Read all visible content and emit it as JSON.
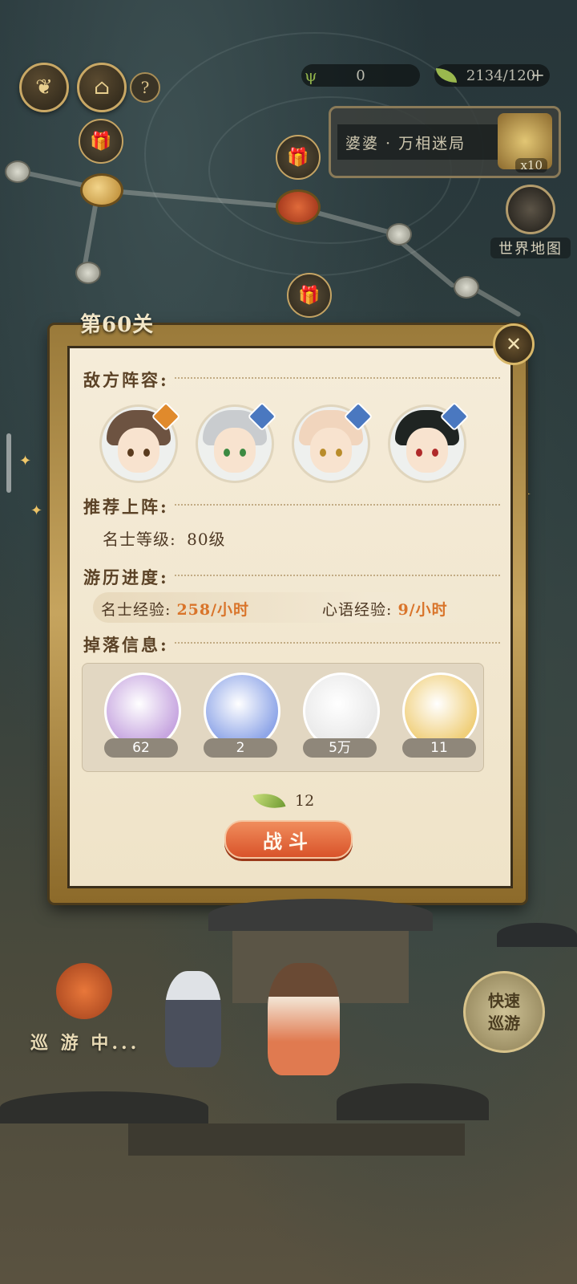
{
  "hud": {
    "resource1_value": "0",
    "resource2_value": "2134/120",
    "plus_symbol": "+",
    "help_symbol": "?"
  },
  "event_card": {
    "title": "婆婆 · 万相迷局",
    "multiplier": "x10"
  },
  "world_map": {
    "label": "世界地图"
  },
  "stage": {
    "title": "第60关",
    "close_symbol": "✕"
  },
  "sections": {
    "enemy_lineup": "敌方阵容:",
    "recommended": "推荐上阵:",
    "progress": "游历进度:",
    "drops": "掉落信息:"
  },
  "recommend": {
    "level_label": "名士等级:",
    "level_value": "80级"
  },
  "experience": {
    "scholar_label": "名士经验:",
    "scholar_value": "258/小时",
    "heart_label": "心语经验:",
    "heart_value": "9/小时"
  },
  "enemies": [
    {
      "name": "enemy-1",
      "hair": "#6d5341",
      "eye": "#5a3b1e",
      "badge": "#e08a2c"
    },
    {
      "name": "enemy-2",
      "hair": "#c9cccf",
      "eye": "#3c8a42",
      "badge": "#4a78c0"
    },
    {
      "name": "enemy-3",
      "hair": "#f1d5bd",
      "eye": "#b98c2a",
      "badge": "#4a78c0"
    },
    {
      "name": "enemy-4",
      "hair": "#1f2422",
      "eye": "#b02a2a",
      "badge": "#4a78c0"
    }
  ],
  "drops": [
    {
      "count": "62",
      "bg": "#c7a6e0"
    },
    {
      "count": "2",
      "bg": "#8fa6e8"
    },
    {
      "count": "5万",
      "bg": "#e9e9e9"
    },
    {
      "count": "11",
      "bg": "#f0cf7a"
    }
  ],
  "cost": {
    "value": "12"
  },
  "fight_button": {
    "label": "战斗"
  },
  "quick_tour": {
    "line1": "快速",
    "line2": "巡游"
  },
  "touring_status": "巡 游 中..."
}
